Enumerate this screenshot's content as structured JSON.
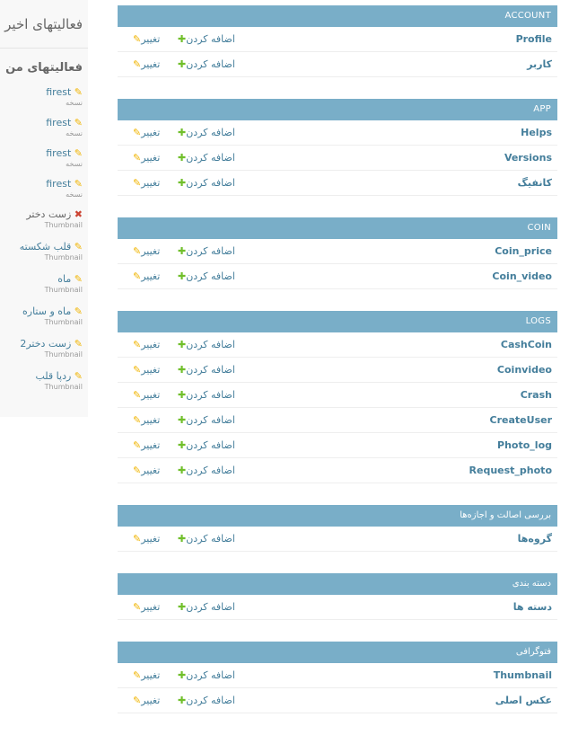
{
  "sidebar": {
    "recent_title": "فعالیتهای اخیر",
    "my_title": "فعالیتهای من",
    "items": [
      {
        "label": "firest",
        "sub": "نسخه",
        "icon": "pencil-icon"
      },
      {
        "label": "firest",
        "sub": "نسخه",
        "icon": "pencil-icon"
      },
      {
        "label": "firest",
        "sub": "نسخه",
        "icon": "pencil-icon"
      },
      {
        "label": "firest",
        "sub": "نسخه",
        "icon": "pencil-icon"
      },
      {
        "label": "زست دختر",
        "sub": "Thumbnail",
        "icon": "delete-icon"
      },
      {
        "label": "قلب شکسته",
        "sub": "Thumbnail",
        "icon": "pencil-icon"
      },
      {
        "label": "ماه",
        "sub": "Thumbnail",
        "icon": "pencil-icon"
      },
      {
        "label": "ماه و ستاره",
        "sub": "Thumbnail",
        "icon": "pencil-icon"
      },
      {
        "label": "زست دختر2",
        "sub": "Thumbnail",
        "icon": "pencil-icon"
      },
      {
        "label": "ردپا قلب",
        "sub": "Thumbnail",
        "icon": "pencil-icon"
      }
    ]
  },
  "actions": {
    "add_label": "اضافه کردن",
    "change_label": "تغییر"
  },
  "modules": [
    {
      "title": "ACCOUNT",
      "models": [
        "Profile",
        "کاربر"
      ]
    },
    {
      "title": "APP",
      "models": [
        "Helps",
        "Versions",
        "کانفیگ"
      ]
    },
    {
      "title": "COIN",
      "models": [
        "Coin_price",
        "Coin_video"
      ]
    },
    {
      "title": "LOGS",
      "models": [
        "CashCoin",
        "Coinvideo",
        "Crash",
        "CreateUser",
        "Photo_log",
        "Request_photo"
      ]
    },
    {
      "title": "بررسی اصالت و اجازه‌ها",
      "models": [
        "گروه‌ها"
      ]
    },
    {
      "title": "دسته بندی",
      "models": [
        "دسته ها"
      ]
    },
    {
      "title": "فتوگرافی",
      "models": [
        "Thumbnail",
        "عکس اصلی"
      ]
    }
  ],
  "colors": {
    "header_bg": "#79aec8",
    "link": "#447e9b",
    "add_icon": "#70bf2b",
    "change_icon": "#f0b400",
    "delete_icon": "#cc4433"
  }
}
